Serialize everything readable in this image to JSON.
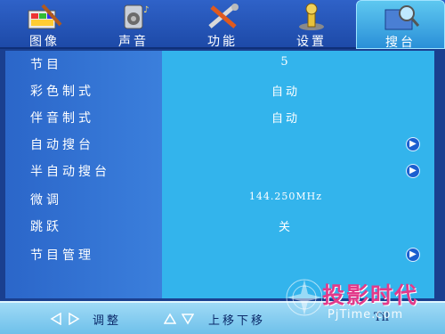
{
  "tabs": [
    {
      "label": "图像",
      "icon": "image-brush-icon"
    },
    {
      "label": "声音",
      "icon": "speaker-sound-icon"
    },
    {
      "label": "功能",
      "icon": "tools-icon"
    },
    {
      "label": "设置",
      "icon": "settings-pedestal-icon"
    },
    {
      "label": "搜台",
      "icon": "search-channel-icon",
      "active": true
    }
  ],
  "menu": {
    "items": [
      {
        "label": "节目",
        "value": "5"
      },
      {
        "label": "彩色制式",
        "value": "自动"
      },
      {
        "label": "伴音制式",
        "value": "自动"
      },
      {
        "label": "自动搜台",
        "value": "",
        "arrow": true
      },
      {
        "label": "半自动搜台",
        "value": "",
        "arrow": true
      },
      {
        "label": "微调",
        "value": "144.250MHz"
      },
      {
        "label": "跳跃",
        "value": "关"
      },
      {
        "label": "节目管理",
        "value": "",
        "arrow": true
      }
    ]
  },
  "hints": {
    "adjust": "调整",
    "move": "上移下移",
    "exit": "Til"
  },
  "watermark": {
    "title": "投影时代",
    "url": "PjTime.com"
  },
  "colors": {
    "panel_left": "#2b66c9",
    "panel_right": "#33b4ec",
    "tab_active": "#5ec8f0",
    "hintbar": "#9fdaf6"
  }
}
